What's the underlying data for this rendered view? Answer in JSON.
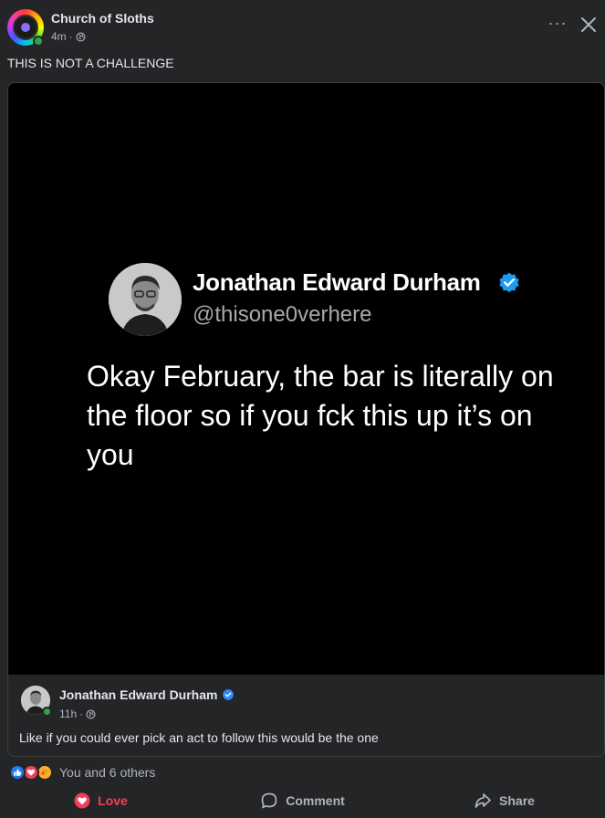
{
  "post": {
    "page_name": "Church of Sloths",
    "time": "4m",
    "separator": "·",
    "text": "THIS IS NOT A CHALLENGE",
    "more_label": "···"
  },
  "shared_image": {
    "tweet_name": "Jonathan Edward Durham",
    "tweet_handle": "@thisone0verhere",
    "tweet_text": "Okay February, the bar is literally on the floor so if you fck this up it’s on you"
  },
  "shared_post": {
    "author": "Jonathan Edward Durham",
    "time": "11h",
    "separator": "·",
    "text": "Like if you could ever pick an act to follow this would be the one"
  },
  "reactions": {
    "types": [
      "like-icon",
      "love-icon",
      "care-icon"
    ],
    "summary": "You and 6 others"
  },
  "actions": {
    "love_label": "Love",
    "comment_label": "Comment",
    "share_label": "Share"
  },
  "colors": {
    "background": "#242526",
    "love": "#f33e58",
    "like": "#2078f4",
    "verified": "#1d9bf0",
    "online": "#31a24c"
  }
}
